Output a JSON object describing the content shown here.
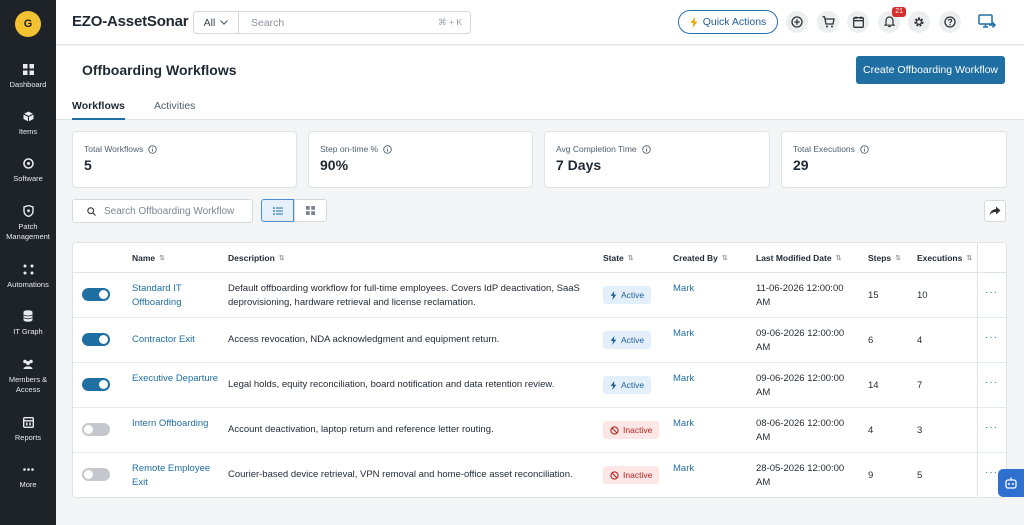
{
  "user": {
    "initial": "G"
  },
  "sidebar": {
    "items": [
      {
        "label": "Dashboard",
        "icon": "dashboard-icon"
      },
      {
        "label": "Items",
        "icon": "box-icon"
      },
      {
        "label": "Software",
        "icon": "disc-icon"
      },
      {
        "label": "Patch Management",
        "icon": "shield-icon"
      },
      {
        "label": "Automations",
        "icon": "automation-icon"
      },
      {
        "label": "IT Graph",
        "icon": "database-icon"
      },
      {
        "label": "Members & Access",
        "icon": "members-icon"
      },
      {
        "label": "Reports",
        "icon": "reports-icon"
      },
      {
        "label": "More",
        "icon": "more-icon"
      }
    ]
  },
  "header": {
    "brand": "EZO-AssetSonar",
    "search": {
      "scope": "All",
      "placeholder": "Search",
      "shortcut": "⌘ + K"
    },
    "quick_actions": "Quick Actions",
    "notification_count": "21"
  },
  "page": {
    "title": "Offboarding Workflows",
    "create_button": "Create Offboarding Workflow",
    "tabs": [
      {
        "label": "Workflows",
        "active": true
      },
      {
        "label": "Activities",
        "active": false
      }
    ]
  },
  "stats": [
    {
      "label": "Total Workflows",
      "value": "5"
    },
    {
      "label": "Step on-time %",
      "value": "90%"
    },
    {
      "label": "Avg Completion Time",
      "value": "7 Days"
    },
    {
      "label": "Total Executions",
      "value": "29"
    }
  ],
  "toolbar": {
    "search_placeholder": "Search Offboarding Workflow"
  },
  "table": {
    "columns": [
      "Name",
      "Description",
      "State",
      "Created By",
      "Last Modified Date",
      "Steps",
      "Executions"
    ],
    "rows": [
      {
        "enabled": true,
        "name": "Standard IT Offboarding",
        "description": "Default offboarding workflow for full-time employees. Covers IdP deactivation, SaaS deprovisioning, hardware retrieval and license reclamation.",
        "state": "Active",
        "created_by": "Mark",
        "modified": "11-06-2026 12:00:00 AM",
        "steps": "15",
        "executions": "10"
      },
      {
        "enabled": true,
        "name": "Contractor Exit",
        "description": "Access revocation, NDA acknowledgment and equipment return.",
        "state": "Active",
        "created_by": "Mark",
        "modified": "09-06-2026 12:00:00 AM",
        "steps": "6",
        "executions": "4"
      },
      {
        "enabled": true,
        "name": "Executive Departure",
        "description": "Legal holds, equity reconciliation, board notification and data retention review.",
        "state": "Active",
        "created_by": "Mark",
        "modified": "09-06-2026 12:00:00 AM",
        "steps": "14",
        "executions": "7"
      },
      {
        "enabled": false,
        "name": "Intern Offboarding",
        "description": "Account deactivation, laptop return and reference letter routing.",
        "state": "Inactive",
        "created_by": "Mark",
        "modified": "08-06-2026 12:00:00 AM",
        "steps": "4",
        "executions": "3"
      },
      {
        "enabled": false,
        "name": "Remote Employee Exit",
        "description": "Courier-based device retrieval, VPN removal and home-office asset reconciliation.",
        "state": "Inactive",
        "created_by": "Mark",
        "modified": "28-05-2026 12:00:00 AM",
        "steps": "9",
        "executions": "5"
      }
    ]
  },
  "colors": {
    "primary": "#1f6fa3",
    "sidebar": "#1e2328",
    "active_badge": "#e3f0fb",
    "inactive_badge": "#fde6e6"
  }
}
